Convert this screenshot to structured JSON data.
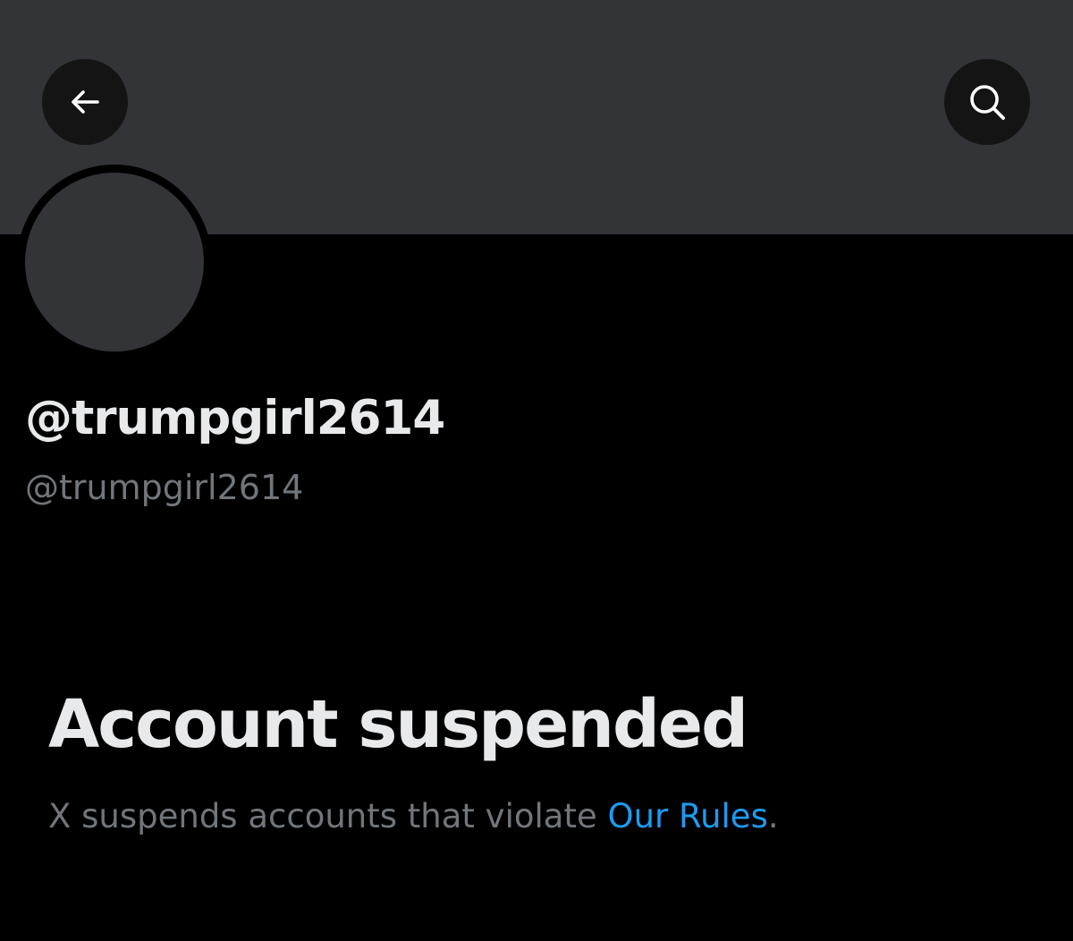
{
  "header": {
    "back_icon": "arrow-left-icon",
    "search_icon": "search-icon"
  },
  "profile": {
    "display_name": "@trumpgirl2614",
    "handle": "@trumpgirl2614"
  },
  "notice": {
    "title": "Account suspended",
    "description": "X suspends accounts that violate ",
    "link_text": "Our Rules",
    "trailing": "."
  },
  "colors": {
    "background": "#000000",
    "banner": "#333438",
    "primary_text": "#e7e9ea",
    "secondary_text": "#71767b",
    "link": "#1d9bf0"
  }
}
